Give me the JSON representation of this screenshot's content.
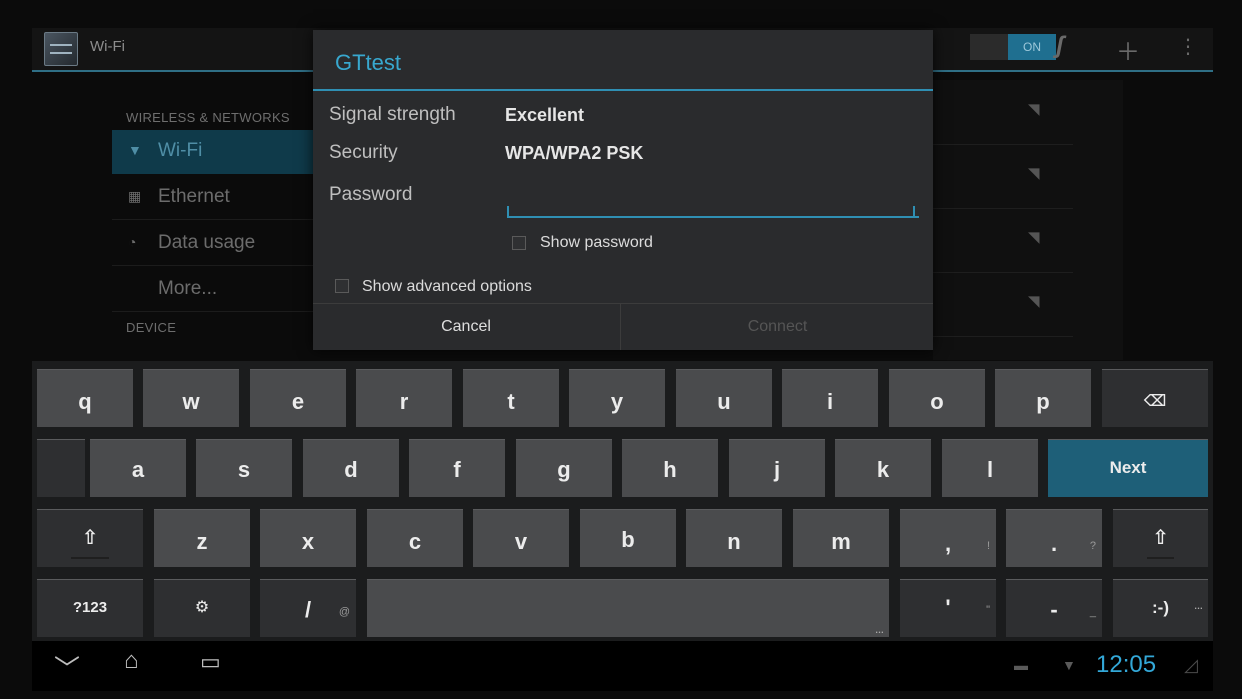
{
  "actionbar": {
    "title": "Wi-Fi",
    "switch_label": "ON",
    "icons": [
      "wifi-settings-icon",
      "wps-icon",
      "add-icon",
      "overflow-menu-icon"
    ]
  },
  "settings": {
    "category_wireless": "WIRELESS & NETWORKS",
    "category_device": "DEVICE",
    "items": [
      {
        "label": "Wi-Fi",
        "icon": "wifi-icon"
      },
      {
        "label": "Ethernet",
        "icon": "ethernet-icon"
      },
      {
        "label": "Data usage",
        "icon": "data-usage-icon"
      },
      {
        "label": "More...",
        "icon": ""
      }
    ]
  },
  "dialog": {
    "title": "GTtest",
    "signal_label": "Signal strength",
    "signal_value": "Excellent",
    "security_label": "Security",
    "security_value": "WPA/WPA2 PSK",
    "password_label": "Password",
    "password_value": "",
    "show_password": "Show password",
    "show_advanced": "Show advanced options",
    "cancel": "Cancel",
    "connect": "Connect"
  },
  "keyboard": {
    "row1": [
      "q",
      "w",
      "e",
      "r",
      "t",
      "y",
      "u",
      "i",
      "o",
      "p"
    ],
    "row2": [
      "a",
      "s",
      "d",
      "f",
      "g",
      "h",
      "j",
      "k",
      "l"
    ],
    "row3": [
      "z",
      "x",
      "c",
      "v",
      "b",
      "n",
      "m",
      ",",
      "."
    ],
    "row3_hints": {
      "comma": "!",
      "period": "?"
    },
    "row4": {
      "symbols": "?123",
      "settings_glyph": "⚙",
      "slash": "/",
      "slash_hint": "@",
      "apostrophe": "'",
      "apostrophe_hint": "\"",
      "dash": "-",
      "dash_hint": "_",
      "smiley": ":-)"
    },
    "next": "Next",
    "shift_glyph": "⇧",
    "backspace_glyph": "⌫"
  },
  "system_bar": {
    "time": "12:05",
    "icons": [
      "back-icon",
      "home-icon",
      "recents-icon",
      "keyboard-status-icon",
      "wifi-status-icon"
    ]
  }
}
